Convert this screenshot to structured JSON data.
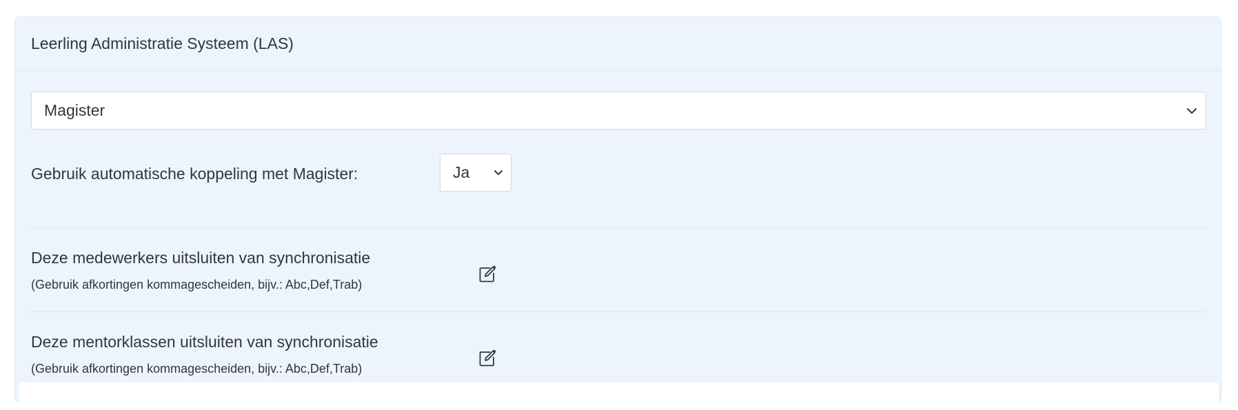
{
  "card": {
    "title": "Leerling Administratie Systeem (LAS)"
  },
  "las_select": {
    "value": "Magister",
    "icon": "chevron-down-icon"
  },
  "auto_link": {
    "label": "Gebruik automatische koppeling met Magister:",
    "value": "Ja",
    "icon": "chevron-down-icon"
  },
  "exclude_staff": {
    "label": "Deze medewerkers uitsluiten van synchronisatie",
    "hint": "(Gebruik afkortingen kommagescheiden, bijv.: Abc,Def,Trab)",
    "icon": "edit-icon"
  },
  "exclude_classes": {
    "label": "Deze mentorklassen uitsluiten van synchronisatie",
    "hint": "(Gebruik afkortingen kommagescheiden, bijv.: Abc,Def,Trab)",
    "icon": "edit-icon"
  },
  "colors": {
    "card_bg": "#edf4fe",
    "text": "#2f3640",
    "border": "#cfd8e3"
  }
}
